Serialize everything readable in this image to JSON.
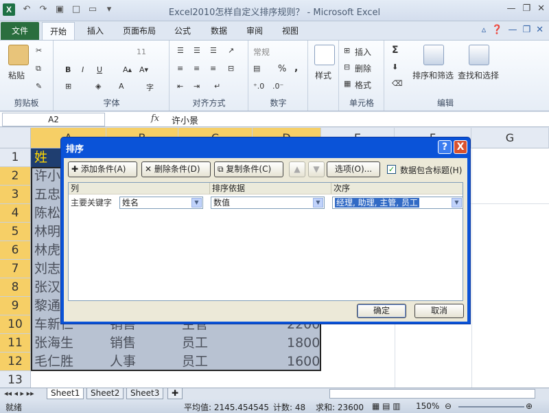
{
  "window": {
    "title": "Excel2010怎样自定义排序规则？ - Microsoft Excel",
    "app_icon": "X"
  },
  "ribbon_tabs": [
    "文件",
    "开始",
    "插入",
    "页面布局",
    "公式",
    "数据",
    "审阅",
    "视图"
  ],
  "ribbon": {
    "clipboard": {
      "paste": "粘贴",
      "label": "剪贴板"
    },
    "font": {
      "size": "11",
      "bold": "B",
      "italic": "I",
      "underline": "U",
      "label": "字体"
    },
    "alignment": {
      "label": "对齐方式"
    },
    "number": {
      "format": "常规",
      "label": "数字",
      "percent": "%",
      "comma": ","
    },
    "styles": {
      "label": "样式"
    },
    "cells": {
      "insert": "插入",
      "delete": "删除",
      "format": "格式",
      "label": "单元格"
    },
    "editing": {
      "sum": "Σ",
      "sort_filter": "排序和筛选",
      "find_select": "查找和选择",
      "label": "编辑"
    }
  },
  "formula_bar": {
    "cell_ref": "A2",
    "fx": "fx",
    "value": "许小景"
  },
  "columns": [
    "A",
    "B",
    "C",
    "D",
    "E",
    "F",
    "G"
  ],
  "rows": [
    "1",
    "2",
    "3",
    "4",
    "5",
    "6",
    "7",
    "8",
    "9",
    "10",
    "11",
    "12",
    "13"
  ],
  "header_cell": "姓",
  "names_partial": [
    "许小",
    "五忠",
    "陈松",
    "林明",
    "林虎",
    "刘志",
    "张汉",
    "黎通"
  ],
  "table_rows": [
    {
      "name": "车新仁",
      "dept": "销售",
      "title": "主管",
      "salary": "2200"
    },
    {
      "name": "张海生",
      "dept": "销售",
      "title": "员工",
      "salary": "1800"
    },
    {
      "name": "毛仁胜",
      "dept": "人事",
      "title": "员工",
      "salary": "1600"
    }
  ],
  "sheets": [
    "Sheet1",
    "Sheet2",
    "Sheet3"
  ],
  "status": {
    "ready": "就绪",
    "average": "平均值: 2145.454545",
    "count": "计数: 48",
    "sum": "求和: 23600",
    "zoom": "150%"
  },
  "dialog": {
    "title": "排序",
    "help": "?",
    "close": "X",
    "add_level": "添加条件(A)",
    "delete_level": "删除条件(D)",
    "copy_level": "复制条件(C)",
    "move_up": "▲",
    "move_down": "▼",
    "options": "选项(O)...",
    "has_headers": "数据包含标题(H)",
    "col_header": "列",
    "sort_on_header": "排序依据",
    "order_header": "次序",
    "row_label": "主要关键字",
    "column_value": "姓名",
    "sort_on_value": "数值",
    "order_value": "经理, 助理, 主管, 员工",
    "ok": "确定",
    "cancel": "取消"
  }
}
